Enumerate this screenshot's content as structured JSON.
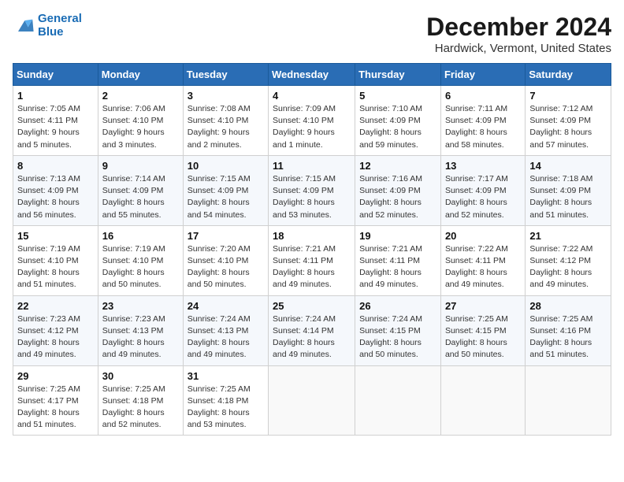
{
  "logo": {
    "line1": "General",
    "line2": "Blue"
  },
  "title": "December 2024",
  "location": "Hardwick, Vermont, United States",
  "days_of_week": [
    "Sunday",
    "Monday",
    "Tuesday",
    "Wednesday",
    "Thursday",
    "Friday",
    "Saturday"
  ],
  "weeks": [
    [
      {
        "day": "1",
        "sunrise": "Sunrise: 7:05 AM",
        "sunset": "Sunset: 4:11 PM",
        "daylight": "Daylight: 9 hours and 5 minutes."
      },
      {
        "day": "2",
        "sunrise": "Sunrise: 7:06 AM",
        "sunset": "Sunset: 4:10 PM",
        "daylight": "Daylight: 9 hours and 3 minutes."
      },
      {
        "day": "3",
        "sunrise": "Sunrise: 7:08 AM",
        "sunset": "Sunset: 4:10 PM",
        "daylight": "Daylight: 9 hours and 2 minutes."
      },
      {
        "day": "4",
        "sunrise": "Sunrise: 7:09 AM",
        "sunset": "Sunset: 4:10 PM",
        "daylight": "Daylight: 9 hours and 1 minute."
      },
      {
        "day": "5",
        "sunrise": "Sunrise: 7:10 AM",
        "sunset": "Sunset: 4:09 PM",
        "daylight": "Daylight: 8 hours and 59 minutes."
      },
      {
        "day": "6",
        "sunrise": "Sunrise: 7:11 AM",
        "sunset": "Sunset: 4:09 PM",
        "daylight": "Daylight: 8 hours and 58 minutes."
      },
      {
        "day": "7",
        "sunrise": "Sunrise: 7:12 AM",
        "sunset": "Sunset: 4:09 PM",
        "daylight": "Daylight: 8 hours and 57 minutes."
      }
    ],
    [
      {
        "day": "8",
        "sunrise": "Sunrise: 7:13 AM",
        "sunset": "Sunset: 4:09 PM",
        "daylight": "Daylight: 8 hours and 56 minutes."
      },
      {
        "day": "9",
        "sunrise": "Sunrise: 7:14 AM",
        "sunset": "Sunset: 4:09 PM",
        "daylight": "Daylight: 8 hours and 55 minutes."
      },
      {
        "day": "10",
        "sunrise": "Sunrise: 7:15 AM",
        "sunset": "Sunset: 4:09 PM",
        "daylight": "Daylight: 8 hours and 54 minutes."
      },
      {
        "day": "11",
        "sunrise": "Sunrise: 7:15 AM",
        "sunset": "Sunset: 4:09 PM",
        "daylight": "Daylight: 8 hours and 53 minutes."
      },
      {
        "day": "12",
        "sunrise": "Sunrise: 7:16 AM",
        "sunset": "Sunset: 4:09 PM",
        "daylight": "Daylight: 8 hours and 52 minutes."
      },
      {
        "day": "13",
        "sunrise": "Sunrise: 7:17 AM",
        "sunset": "Sunset: 4:09 PM",
        "daylight": "Daylight: 8 hours and 52 minutes."
      },
      {
        "day": "14",
        "sunrise": "Sunrise: 7:18 AM",
        "sunset": "Sunset: 4:09 PM",
        "daylight": "Daylight: 8 hours and 51 minutes."
      }
    ],
    [
      {
        "day": "15",
        "sunrise": "Sunrise: 7:19 AM",
        "sunset": "Sunset: 4:10 PM",
        "daylight": "Daylight: 8 hours and 51 minutes."
      },
      {
        "day": "16",
        "sunrise": "Sunrise: 7:19 AM",
        "sunset": "Sunset: 4:10 PM",
        "daylight": "Daylight: 8 hours and 50 minutes."
      },
      {
        "day": "17",
        "sunrise": "Sunrise: 7:20 AM",
        "sunset": "Sunset: 4:10 PM",
        "daylight": "Daylight: 8 hours and 50 minutes."
      },
      {
        "day": "18",
        "sunrise": "Sunrise: 7:21 AM",
        "sunset": "Sunset: 4:11 PM",
        "daylight": "Daylight: 8 hours and 49 minutes."
      },
      {
        "day": "19",
        "sunrise": "Sunrise: 7:21 AM",
        "sunset": "Sunset: 4:11 PM",
        "daylight": "Daylight: 8 hours and 49 minutes."
      },
      {
        "day": "20",
        "sunrise": "Sunrise: 7:22 AM",
        "sunset": "Sunset: 4:11 PM",
        "daylight": "Daylight: 8 hours and 49 minutes."
      },
      {
        "day": "21",
        "sunrise": "Sunrise: 7:22 AM",
        "sunset": "Sunset: 4:12 PM",
        "daylight": "Daylight: 8 hours and 49 minutes."
      }
    ],
    [
      {
        "day": "22",
        "sunrise": "Sunrise: 7:23 AM",
        "sunset": "Sunset: 4:12 PM",
        "daylight": "Daylight: 8 hours and 49 minutes."
      },
      {
        "day": "23",
        "sunrise": "Sunrise: 7:23 AM",
        "sunset": "Sunset: 4:13 PM",
        "daylight": "Daylight: 8 hours and 49 minutes."
      },
      {
        "day": "24",
        "sunrise": "Sunrise: 7:24 AM",
        "sunset": "Sunset: 4:13 PM",
        "daylight": "Daylight: 8 hours and 49 minutes."
      },
      {
        "day": "25",
        "sunrise": "Sunrise: 7:24 AM",
        "sunset": "Sunset: 4:14 PM",
        "daylight": "Daylight: 8 hours and 49 minutes."
      },
      {
        "day": "26",
        "sunrise": "Sunrise: 7:24 AM",
        "sunset": "Sunset: 4:15 PM",
        "daylight": "Daylight: 8 hours and 50 minutes."
      },
      {
        "day": "27",
        "sunrise": "Sunrise: 7:25 AM",
        "sunset": "Sunset: 4:15 PM",
        "daylight": "Daylight: 8 hours and 50 minutes."
      },
      {
        "day": "28",
        "sunrise": "Sunrise: 7:25 AM",
        "sunset": "Sunset: 4:16 PM",
        "daylight": "Daylight: 8 hours and 51 minutes."
      }
    ],
    [
      {
        "day": "29",
        "sunrise": "Sunrise: 7:25 AM",
        "sunset": "Sunset: 4:17 PM",
        "daylight": "Daylight: 8 hours and 51 minutes."
      },
      {
        "day": "30",
        "sunrise": "Sunrise: 7:25 AM",
        "sunset": "Sunset: 4:18 PM",
        "daylight": "Daylight: 8 hours and 52 minutes."
      },
      {
        "day": "31",
        "sunrise": "Sunrise: 7:25 AM",
        "sunset": "Sunset: 4:18 PM",
        "daylight": "Daylight: 8 hours and 53 minutes."
      },
      null,
      null,
      null,
      null
    ]
  ]
}
